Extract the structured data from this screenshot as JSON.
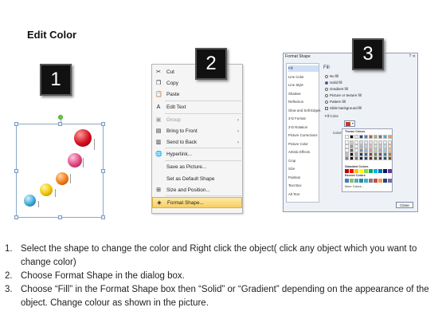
{
  "title": "Edit Color",
  "badges": {
    "one": "1",
    "two": "2",
    "three": "3"
  },
  "context_menu": {
    "items": [
      {
        "label": "Cut",
        "icon": "scissors-icon",
        "glyph": "✂",
        "disabled": false,
        "submenu": false,
        "highlight": false
      },
      {
        "label": "Copy",
        "icon": "copy-icon",
        "glyph": "❐",
        "disabled": false,
        "submenu": false,
        "highlight": false
      },
      {
        "label": "Paste",
        "icon": "paste-icon",
        "glyph": "📋",
        "disabled": false,
        "submenu": false,
        "highlight": false
      },
      {
        "label": "Edit Text",
        "icon": "edit-text-icon",
        "glyph": "A",
        "disabled": false,
        "submenu": false,
        "highlight": false
      },
      {
        "label": "Group",
        "icon": "group-icon",
        "glyph": "▣",
        "disabled": true,
        "submenu": true,
        "highlight": false
      },
      {
        "label": "Bring to Front",
        "icon": "bring-front-icon",
        "glyph": "▤",
        "disabled": false,
        "submenu": true,
        "highlight": false
      },
      {
        "label": "Send to Back",
        "icon": "send-back-icon",
        "glyph": "▥",
        "disabled": false,
        "submenu": true,
        "highlight": false
      },
      {
        "label": "Hyperlink...",
        "icon": "hyperlink-icon",
        "glyph": "🌐",
        "disabled": false,
        "submenu": false,
        "highlight": false
      },
      {
        "label": "Save as Picture...",
        "icon": "",
        "glyph": "",
        "disabled": false,
        "submenu": false,
        "highlight": false
      },
      {
        "label": "Set as Default Shape",
        "icon": "",
        "glyph": "",
        "disabled": false,
        "submenu": false,
        "highlight": false
      },
      {
        "label": "Size and Position...",
        "icon": "size-position-icon",
        "glyph": "⊞",
        "disabled": false,
        "submenu": false,
        "highlight": false
      },
      {
        "label": "Format Shape...",
        "icon": "format-shape-icon",
        "glyph": "◈",
        "disabled": false,
        "submenu": false,
        "highlight": true
      }
    ]
  },
  "dialog": {
    "title": "Format Shape",
    "controls": "? ✕",
    "categories": [
      "Fill",
      "Line Color",
      "Line Style",
      "Shadow",
      "Reflection",
      "Glow and Soft Edges",
      "3-D Format",
      "3-D Rotation",
      "Picture Corrections",
      "Picture Color",
      "Artistic Effects",
      "Crop",
      "Size",
      "Position",
      "Text Box",
      "Alt Text"
    ],
    "selected_category": "Fill",
    "fill_heading": "Fill",
    "options": [
      {
        "label": "No fill",
        "type": "radio",
        "on": false
      },
      {
        "label": "Solid fill",
        "type": "radio",
        "on": true
      },
      {
        "label": "Gradient fill",
        "type": "radio",
        "on": false
      },
      {
        "label": "Picture or texture fill",
        "type": "radio",
        "on": false
      },
      {
        "label": "Pattern fill",
        "type": "radio",
        "on": false
      },
      {
        "label": "Slide background fill",
        "type": "check",
        "on": false
      }
    ],
    "fill_color_label": "Fill Color",
    "color_label": "Color:",
    "palette": {
      "theme_label": "Theme Colors",
      "standard_label": "Standard Colors",
      "recent_label": "Recent Colors",
      "more_label": "More Colors...",
      "theme_top": [
        "#ffffff",
        "#000000",
        "#eeece1",
        "#1f497d",
        "#4f81bd",
        "#c0504d",
        "#9bbb59",
        "#8064a2",
        "#4bacc6",
        "#f79646"
      ],
      "standard": [
        "#c00000",
        "#ff0000",
        "#ffc000",
        "#ffff00",
        "#92d050",
        "#00b050",
        "#00b0f0",
        "#0070c0",
        "#002060",
        "#7030a0"
      ],
      "recent": [
        "#3f7fbf",
        "#9bbb59",
        "#4bacc6",
        "#31859c",
        "#4bacc6",
        "#7f7f7f",
        "#c0504d",
        "#f79646",
        "#1f497d",
        "#8064a2"
      ]
    },
    "close_label": "Close"
  },
  "instructions": [
    {
      "num": "1.",
      "text": "Select the shape to change the color and Right click the object( click any object which you want to change color)"
    },
    {
      "num": "2.",
      "text": "Choose Format Shape in the dialog box."
    },
    {
      "num": "3.",
      "text": "Choose “Fill” in the Format Shape box then “Solid” or “Gradient” depending on the appearance of the object. Change colour as shown in the picture."
    }
  ]
}
